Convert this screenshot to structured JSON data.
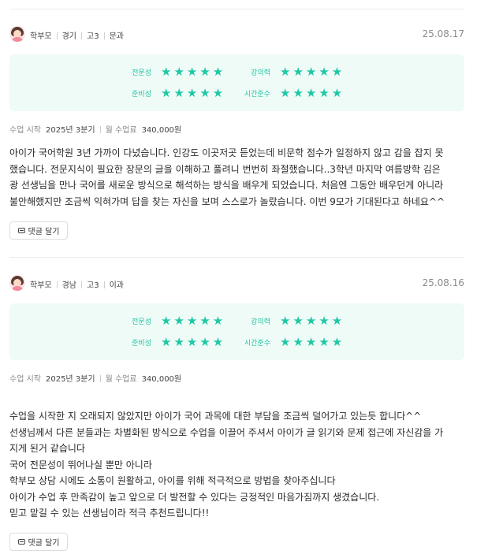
{
  "reviews": [
    {
      "author": "학부모",
      "region": "경기",
      "grade": "고3",
      "track": "문과",
      "date": "25.08.17",
      "ratings": [
        {
          "label": "전문성",
          "stars": 5
        },
        {
          "label": "강의력",
          "stars": 5
        },
        {
          "label": "준비성",
          "stars": 5
        },
        {
          "label": "시간준수",
          "stars": 5
        }
      ],
      "start_label": "수업 시작",
      "start_value": "2025년 3분기",
      "fee_label": "월 수업료",
      "fee_value": "340,000원",
      "body": [
        "아이가 국어학원 3년 가까이 다녔습니다. 인강도 이곳저곳 듣었는데 비문학 점수가 일정하지 않고 감을 잡지 못",
        "했습니다. 전문지식이 필요한 장문의 글을 이해하고 풀려니 번번히 좌절했습니다..3학년 마지막 여름방학 김은",
        "광 선생님을 만나 국어를 새로운 방식으로 해석하는 방식을 배우게 되었습니다. 처음엔 그동안 배우던게 아니라",
        "불안해했지만 조금씩 익혀가며 답을 찾는 자신을 보며 스스로가 놀랐습니다. 이번 9모가 기대된다고 하네요^^"
      ],
      "reply_label": "댓글 달기"
    },
    {
      "author": "학부모",
      "region": "경남",
      "grade": "고3",
      "track": "이과",
      "date": "25.08.16",
      "ratings": [
        {
          "label": "전문성",
          "stars": 5
        },
        {
          "label": "강의력",
          "stars": 5
        },
        {
          "label": "준비성",
          "stars": 5
        },
        {
          "label": "시간준수",
          "stars": 5
        }
      ],
      "start_label": "수업 시작",
      "start_value": "2025년 3분기",
      "fee_label": "월 수업료",
      "fee_value": "340,000원",
      "body": [
        "수업을 시작한 지 오래되지 않았지만 아이가 국어 과목에 대한 부담을 조금씩 덜어가고 있는듯 합니다^^",
        "선생님께서 다른 분들과는 차별화된 방식으로 수업을 이끌어 주셔서 아이가 글 읽기와 문제 접근에 자신감을 가",
        "지게 된거 같습니다",
        "국어 전문성이 뛰어나실 뿐만 아니라",
        "학부모 상담 시에도 소통이 원활하고, 아이를 위해 적극적으로 방법을 찾아주십니다",
        "아이가 수업 후 만족감이 높고 앞으로 더 발전할 수 있다는 긍정적인 마음가짐까지 생겼습니다.",
        "믿고 맡길 수 있는 선생님이라 적극 추천드립니다!!"
      ],
      "reply_label": "댓글 달기"
    }
  ],
  "colors": {
    "accent": "#1ec8a5",
    "rating_bg": "#eefbf7",
    "divider": "#ececec"
  },
  "icons": {
    "avatar": "parent-avatar-icon",
    "star": "star-icon",
    "reply": "comment-icon"
  }
}
